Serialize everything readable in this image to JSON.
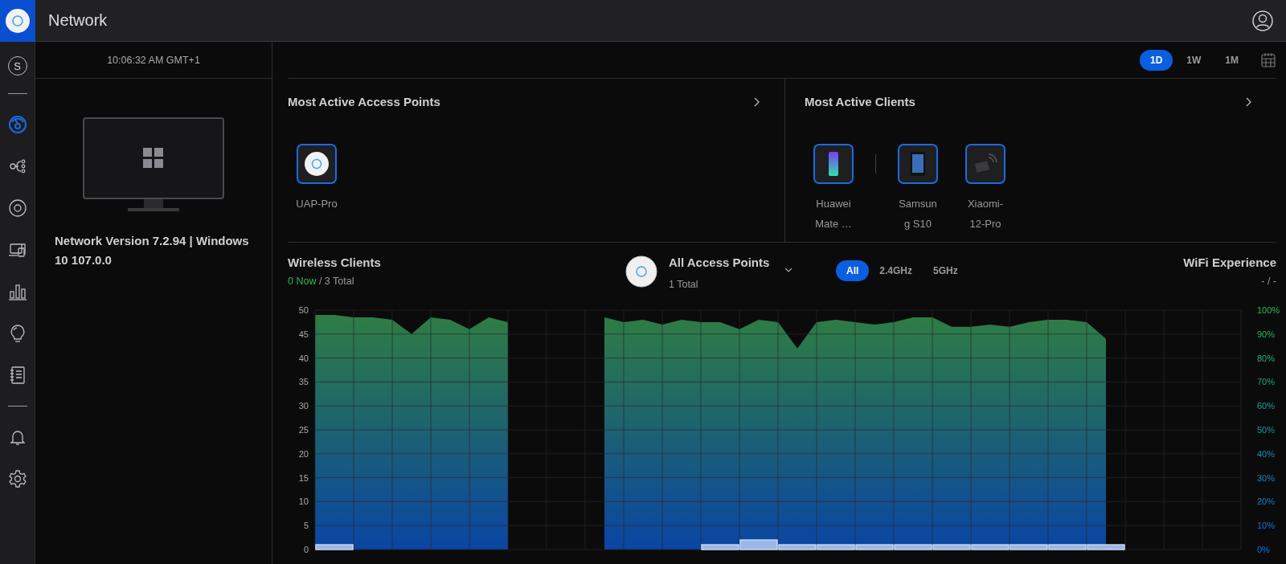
{
  "app": {
    "title": "Network"
  },
  "sidebar": {
    "groups": [
      [
        {
          "kind": "avatar",
          "label": "S",
          "selected": false
        }
      ],
      [
        {
          "kind": "dashboard",
          "selected": true
        },
        {
          "kind": "topology",
          "selected": false
        },
        {
          "kind": "devices",
          "selected": false
        },
        {
          "kind": "clients",
          "selected": false
        },
        {
          "kind": "statistics",
          "selected": false
        },
        {
          "kind": "insights",
          "selected": false
        },
        {
          "kind": "logs",
          "selected": false
        }
      ],
      [
        {
          "kind": "alerts",
          "selected": false
        },
        {
          "kind": "settings",
          "selected": false
        }
      ]
    ]
  },
  "left_panel": {
    "time": "10:06:32 AM GMT+1",
    "caption": "Network Version 7.2.94 | Windows 10 107.0.0"
  },
  "range_tabs": [
    {
      "label": "1D",
      "selected": true
    },
    {
      "label": "1W",
      "selected": false
    },
    {
      "label": "1M",
      "selected": false
    }
  ],
  "most_active_access_points": {
    "title": "Most Active Access Points",
    "items": [
      {
        "name": "UAP-Pro",
        "kind": "access-point"
      }
    ]
  },
  "most_active_clients": {
    "title": "Most Active Clients",
    "items": [
      {
        "name": "Huawei Mate …",
        "kind": "phone"
      },
      {
        "name": "Samsung S10",
        "kind": "tablet"
      },
      {
        "name": "Xiaomi-12-Pro",
        "kind": "generic"
      }
    ]
  },
  "wireless_clients": {
    "title": "Wireless Clients",
    "now": "0 Now",
    "total": "/ 3 Total",
    "ap_filter": {
      "title": "All Access Points",
      "subtitle": "1 Total"
    },
    "band_tabs": [
      {
        "label": "All",
        "selected": true
      },
      {
        "label": "2.4GHz",
        "selected": false
      },
      {
        "label": "5GHz",
        "selected": false
      }
    ],
    "wifi_experience": {
      "title": "WiFi Experience",
      "value": "- / -",
      "axis_labels": [
        "100%",
        "90%",
        "80%",
        "70%",
        "60%",
        "50%",
        "40%",
        "30%",
        "20%",
        "10%",
        "0%"
      ]
    },
    "chart_data": {
      "type": "bar",
      "grid": true,
      "ylim": [
        0,
        50
      ],
      "yticks": [
        0,
        5,
        10,
        15,
        20,
        25,
        30,
        35,
        40,
        45,
        50
      ],
      "series": [
        {
          "color": "#9bb7e6",
          "values": [
            1,
            0,
            0,
            0,
            0,
            null,
            null,
            0,
            0,
            0,
            1,
            2,
            1,
            1,
            1,
            1,
            1,
            1,
            1,
            1,
            1,
            null,
            null,
            null
          ]
        }
      ]
    }
  }
}
